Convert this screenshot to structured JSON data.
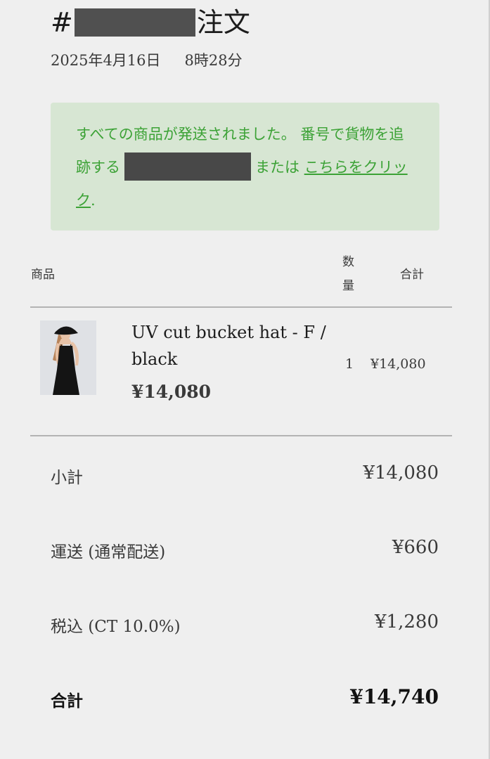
{
  "order": {
    "title_prefix": "#",
    "title_suffix": "注文",
    "date": "2025年4月16日",
    "time": "8時28分"
  },
  "notice": {
    "text_part1": "すべての商品が発送されました。 番号で貨物を追跡する",
    "text_part2": "または",
    "link_text": "こちらをクリック",
    "text_end": ".",
    "colors": {
      "background": "#d7e6d3",
      "text": "#3ca236"
    }
  },
  "table": {
    "headers": {
      "product": "商品",
      "quantity": "数量",
      "total": "合計"
    }
  },
  "item": {
    "name": "UV cut bucket hat - F / black",
    "price": "¥14,080",
    "quantity": "1",
    "line_total": "¥14,080"
  },
  "summary": {
    "subtotal": {
      "label": "小計",
      "value": "¥14,080"
    },
    "shipping": {
      "label": "運送 (通常配送)",
      "value": "¥660"
    },
    "tax": {
      "label": "税込 (CT 10.0%)",
      "value": "¥1,280"
    },
    "total": {
      "label": "合計",
      "value": "¥14,740"
    }
  }
}
